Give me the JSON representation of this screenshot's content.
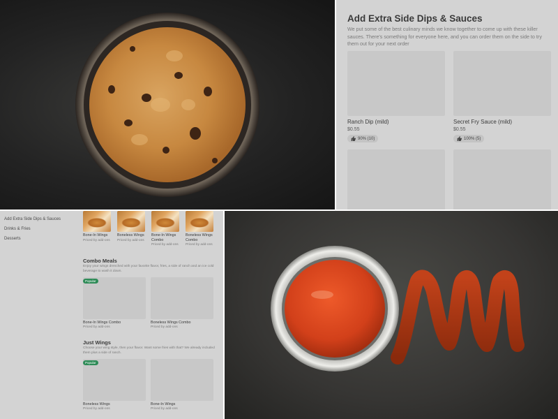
{
  "sauces_panel": {
    "title": "Add Extra Side Dips & Sauces",
    "description": "We put some of the best culinary minds we know together to come up with these killer sauces. There's something for everyone here, and you can order them on the side to try them out for your next order",
    "items": [
      {
        "name": "Ranch Dip (mild)",
        "price": "$0.55",
        "rating": "90% (10)"
      },
      {
        "name": "Secret Fry Sauce (mild)",
        "price": "$0.55",
        "rating": "100% (5)"
      }
    ]
  },
  "menu_panel": {
    "nav": [
      {
        "label": "Add Extra Side Dips & Sauces"
      },
      {
        "label": "Drinks & Fries"
      },
      {
        "label": "Desserts"
      }
    ],
    "top_items": [
      {
        "name": "Bone-In Wings",
        "sub": "Priced by add-ons"
      },
      {
        "name": "Boneless Wings",
        "sub": "Priced by add-ons"
      },
      {
        "name": "Bone-In Wings Combo",
        "sub": "Priced by add-ons"
      },
      {
        "name": "Boneless Wings Combo",
        "sub": "Priced by add-ons"
      }
    ],
    "combo": {
      "title": "Combo Meals",
      "description": "Enjoy your wings drenched with your favorite flavor, fries, a side of ranch and an ice cold beverage to wash it down.",
      "items": [
        {
          "name": "Bone-In Wings Combo",
          "sub": "Priced by add-ons",
          "badge": "Popular"
        },
        {
          "name": "Boneless Wings Combo",
          "sub": "Priced by add-ons",
          "badge": ""
        }
      ]
    },
    "just_wings": {
      "title": "Just Wings",
      "description": "Choose your wing style, then your flavor. Want some fries with that? We already included them plus a side of ranch.",
      "items": [
        {
          "name": "Boneless Wings",
          "sub": "Priced by add-ons",
          "badge": "Popular"
        },
        {
          "name": "Bone-In Wings",
          "sub": "Priced by add-ons",
          "badge": ""
        }
      ]
    }
  },
  "colors": {
    "popular_badge": "#2e8b57",
    "panel_gray": "#d3d3d3",
    "placeholder_gray": "#c8c8c8"
  }
}
